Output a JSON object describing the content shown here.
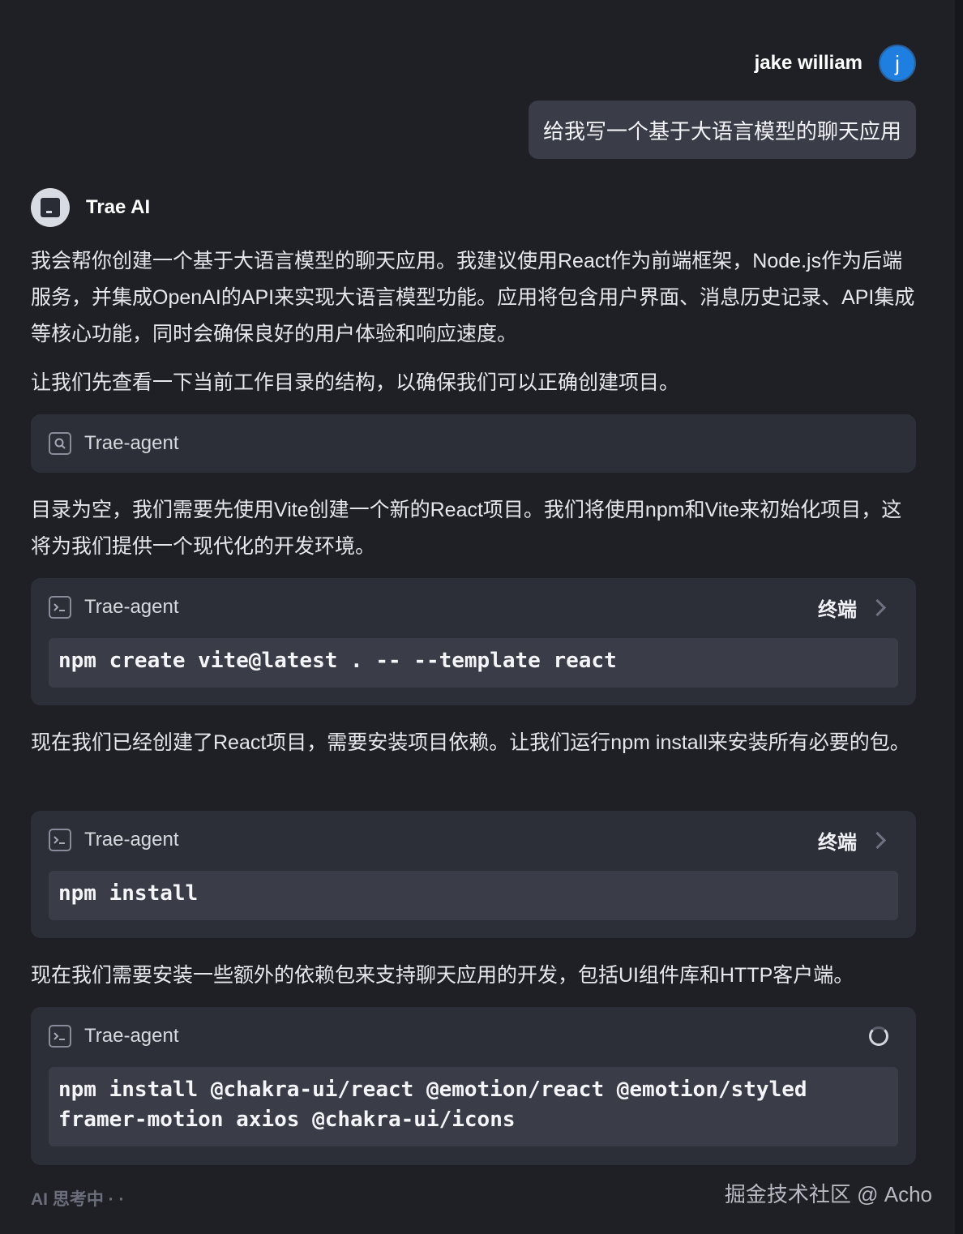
{
  "user": {
    "name": "jake william",
    "avatar_letter": "j",
    "message": "给我写一个基于大语言模型的聊天应用"
  },
  "assistant": {
    "name": "Trae AI"
  },
  "messages": {
    "intro": "我会帮你创建一个基于大语言模型的聊天应用。我建议使用React作为前端框架，Node.js作为后端服务，并集成OpenAI的API来实现大语言模型功能。应用将包含用户界面、消息历史记录、API集成等核心功能，同时会确保良好的用户体验和响应速度。",
    "check_dir": "让我们先查看一下当前工作目录的结构，以确保我们可以正确创建项目。",
    "empty_dir": "目录为空，我们需要先使用Vite创建一个新的React项目。我们将使用npm和Vite来初始化项目，这将为我们提供一个现代化的开发环境。",
    "install_deps": "现在我们已经创建了React项目，需要安装项目依赖。让我们运行npm install来安装所有必要的包。",
    "extra_deps": "现在我们需要安装一些额外的依赖包来支持聊天应用的开发，包括UI组件库和HTTP客户端。"
  },
  "tools": [
    {
      "name": "Trae-agent",
      "icon": "search-icon"
    },
    {
      "name": "Trae-agent",
      "icon": "terminal-icon",
      "action_label": "终端",
      "command": "npm create vite@latest . -- --template react"
    },
    {
      "name": "Trae-agent",
      "icon": "terminal-icon",
      "action_label": "终端",
      "command": "npm install"
    },
    {
      "name": "Trae-agent",
      "icon": "terminal-icon",
      "status": "running",
      "command": "npm install @chakra-ui/react @emotion/react @emotion/styled framer-motion axios @chakra-ui/icons"
    }
  ],
  "status": {
    "thinking": "AI 思考中 · ·"
  },
  "watermark": "掘金技术社区 @ Acho"
}
